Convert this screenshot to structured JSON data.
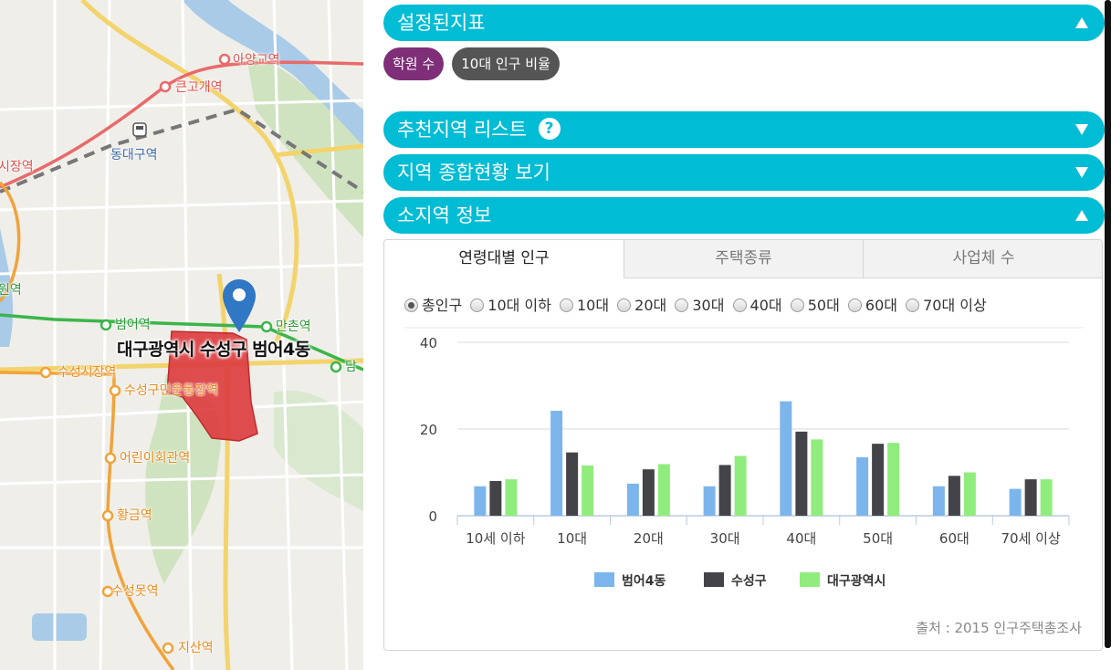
{
  "map": {
    "region_label": "대구광역시 수성구 범어4동",
    "stations": [
      {
        "name": "아양교역",
        "color": "red"
      },
      {
        "name": "큰고개역",
        "color": "red"
      },
      {
        "name": "동대구역",
        "color": "gray"
      },
      {
        "name": "시장역",
        "color": "red"
      },
      {
        "name": "원역",
        "color": "green"
      },
      {
        "name": "범어역",
        "color": "green"
      },
      {
        "name": "만촌역",
        "color": "green"
      },
      {
        "name": "담",
        "color": "green"
      },
      {
        "name": "수성시장역",
        "color": "orange"
      },
      {
        "name": "수성구민운동장역",
        "color": "orange"
      },
      {
        "name": "어린이회관역",
        "color": "orange"
      },
      {
        "name": "황금역",
        "color": "orange"
      },
      {
        "name": "수성못역",
        "color": "orange"
      },
      {
        "name": "지산역",
        "color": "orange"
      }
    ]
  },
  "panel": {
    "sections": [
      {
        "title": "설정된지표",
        "state": "expanded"
      },
      {
        "title": "추천지역 리스트",
        "state": "collapsed",
        "help": "?"
      },
      {
        "title": "지역 종합현황 보기",
        "state": "collapsed"
      },
      {
        "title": "소지역 정보",
        "state": "expanded"
      }
    ],
    "chips": [
      {
        "label": "학원 수",
        "color": "#7e2f78"
      },
      {
        "label": "10대 인구 비율",
        "color": "#555555"
      }
    ],
    "tabs": [
      "연령대별 인구",
      "주택종류",
      "사업체 수"
    ],
    "active_tab": "연령대별 인구",
    "radio_options": [
      "총인구",
      "10대 이하",
      "10대",
      "20대",
      "30대",
      "40대",
      "50대",
      "60대",
      "70대 이상"
    ],
    "radio_selected": "총인구",
    "source": "출처 : 2015 인구주택총조사"
  },
  "colors": {
    "accent": "#00bcd4"
  },
  "chart_data": {
    "type": "bar",
    "categories": [
      "10세 이하",
      "10대",
      "20대",
      "30대",
      "40대",
      "50대",
      "60대",
      "70세 이상"
    ],
    "series": [
      {
        "name": "범어4동",
        "color": "#7cb5ec",
        "values": [
          6.8,
          24.2,
          7.4,
          6.8,
          26.4,
          13.5,
          6.8,
          6.2
        ]
      },
      {
        "name": "수성구",
        "color": "#434348",
        "values": [
          8.0,
          14.6,
          10.7,
          11.7,
          19.4,
          16.6,
          9.2,
          8.4
        ]
      },
      {
        "name": "대구광역시",
        "color": "#90ed7d",
        "values": [
          8.4,
          11.6,
          11.9,
          13.8,
          17.6,
          16.8,
          10.0,
          8.4
        ]
      }
    ],
    "yticks": [
      0,
      20,
      40
    ],
    "ylim": [
      0,
      40
    ],
    "grid": true,
    "legend": "bottom"
  }
}
